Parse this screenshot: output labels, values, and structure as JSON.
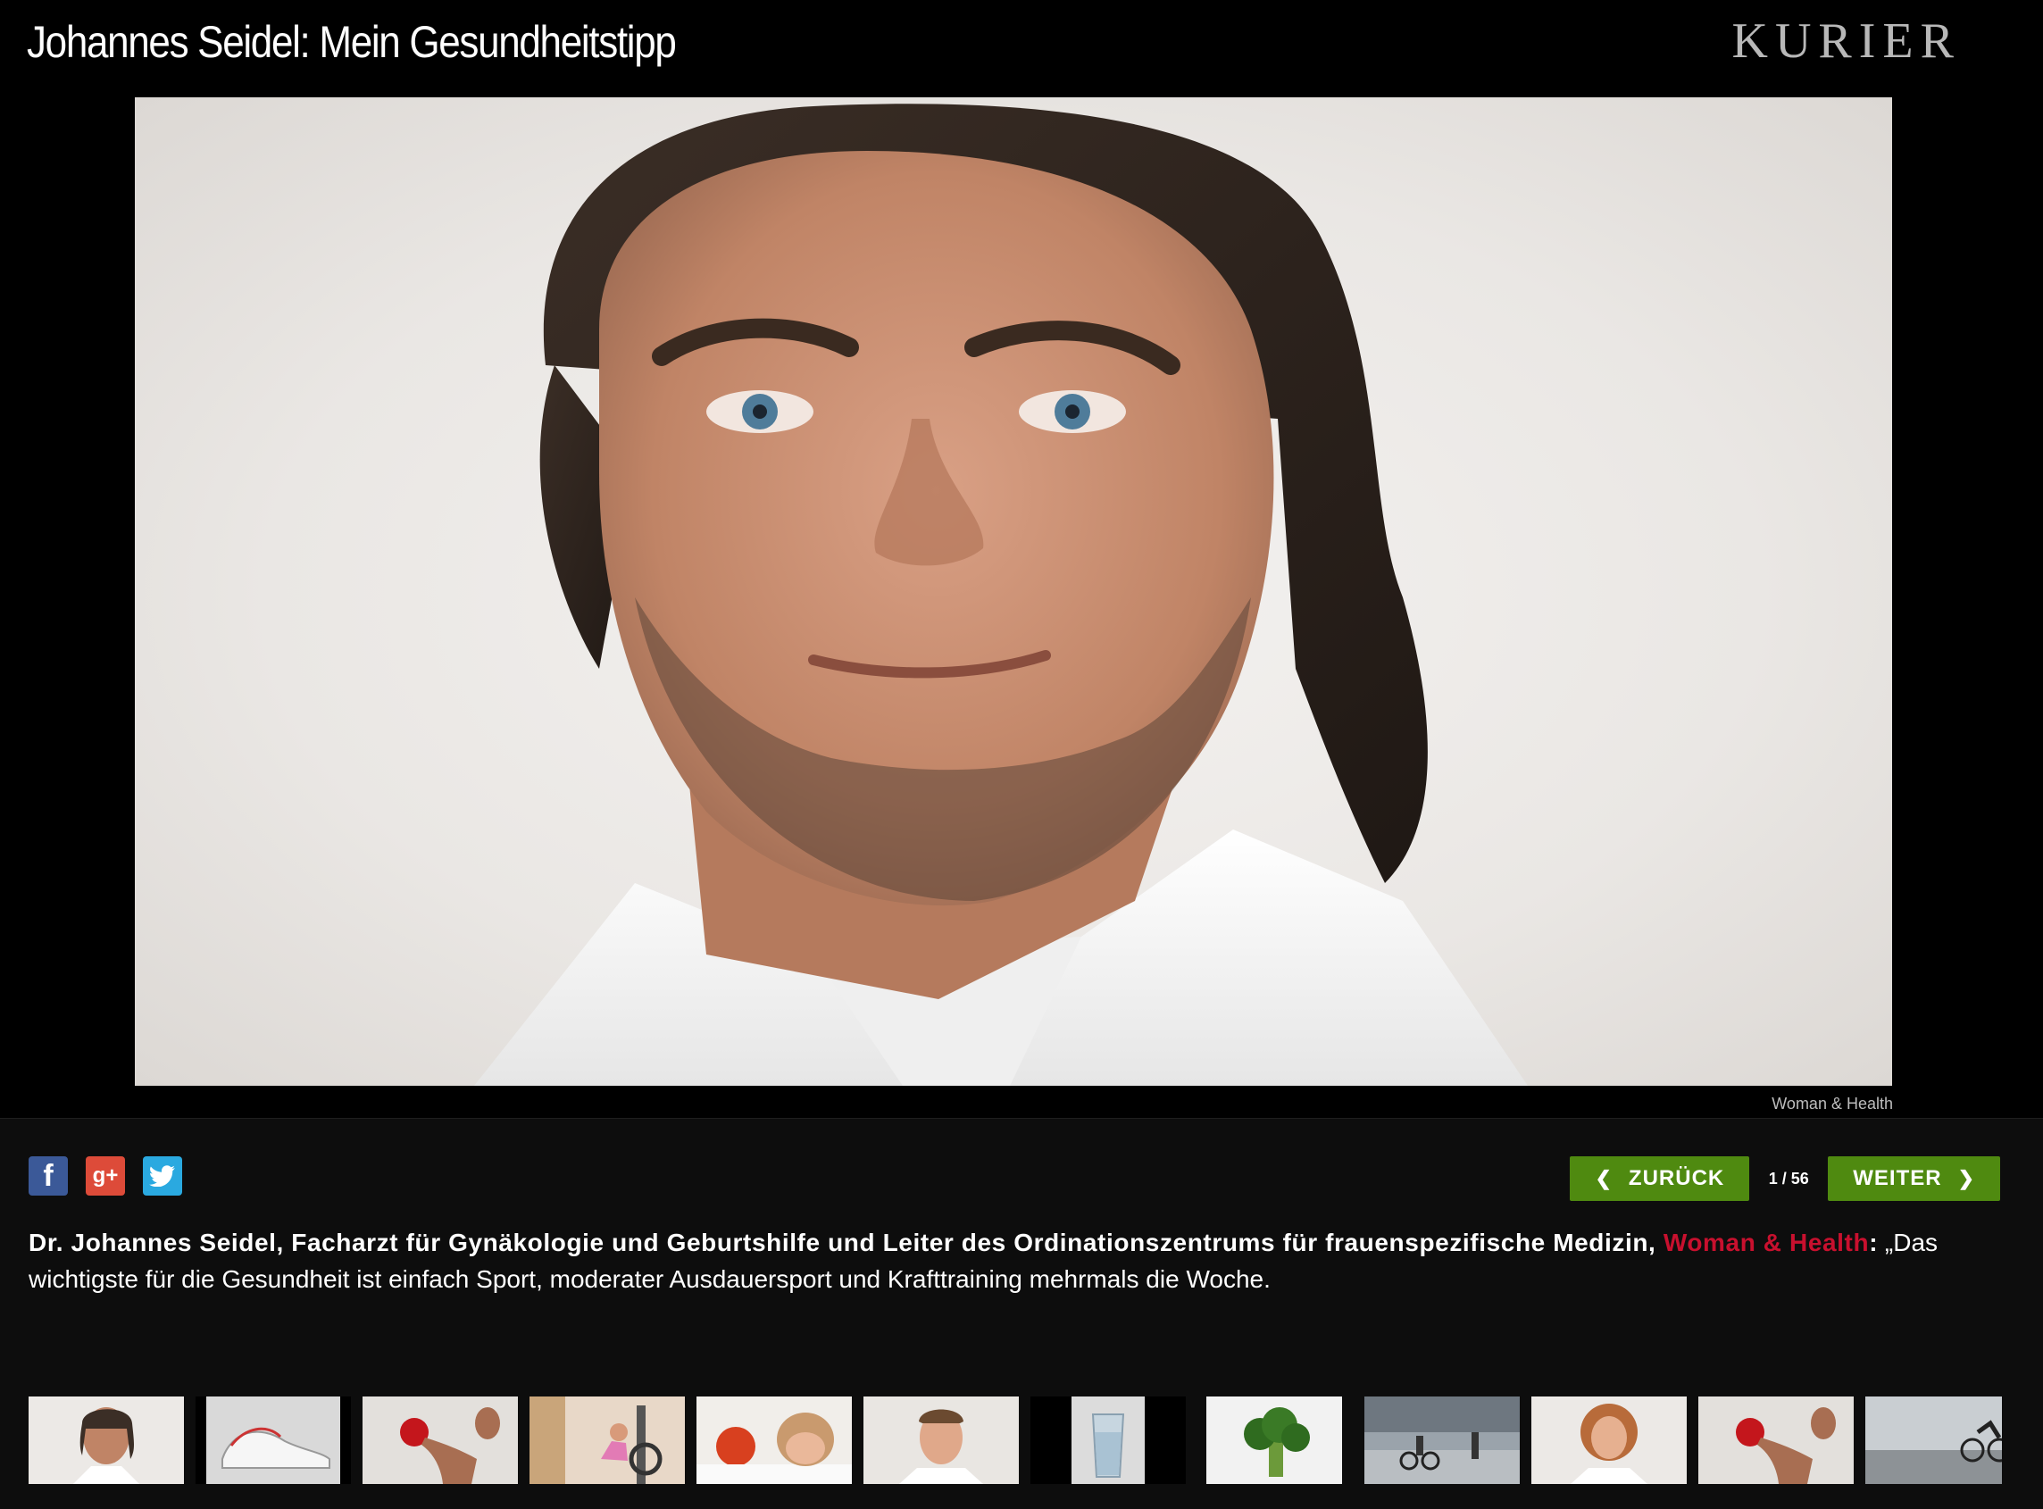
{
  "header": {
    "title": "Johannes Seidel: Mein Gesundheitstipp",
    "brand": "KURIER"
  },
  "photo": {
    "credit": "Woman & Health"
  },
  "social": {
    "items": [
      "facebook-icon",
      "google-plus-icon",
      "twitter-icon"
    ],
    "google_plus_label": "g+"
  },
  "nav": {
    "prev_label": "ZURÜCK",
    "next_label": "WEITER",
    "counter": "1 / 56",
    "current_index": 1,
    "total": 56
  },
  "caption": {
    "bold_text": "Dr. Johannes Seidel, Facharzt für Gynäkologie und Geburtshilfe und Leiter des Ordinationszentrums für frauenspezifische Medizin, ",
    "link_text": "Woman & Health",
    "colon": ":",
    "quote": " „Das wichtigste für die Gesundheit ist einfach Sport, moderater Ausdauersport und Krafttraining mehrmals die Woche."
  },
  "colors": {
    "accent_green": "#4f8a10",
    "link_red": "#c8102e",
    "background": "#000000",
    "panel": "#0d0d0d"
  },
  "thumbnails": [
    {
      "subject": "portrait-man",
      "active": true
    },
    {
      "subject": "sneakers",
      "active": false
    },
    {
      "subject": "boxer-red-glove",
      "active": false
    },
    {
      "subject": "gym-workout",
      "active": false
    },
    {
      "subject": "girl-with-apple",
      "active": false
    },
    {
      "subject": "portrait-young-man",
      "active": false
    },
    {
      "subject": "glass-of-water",
      "active": false
    },
    {
      "subject": "broccoli",
      "active": false
    },
    {
      "subject": "cyclists-street",
      "active": false
    },
    {
      "subject": "portrait-woman",
      "active": false
    },
    {
      "subject": "boxer-red-glove",
      "active": false
    },
    {
      "subject": "cyclist-road",
      "active": false
    }
  ]
}
